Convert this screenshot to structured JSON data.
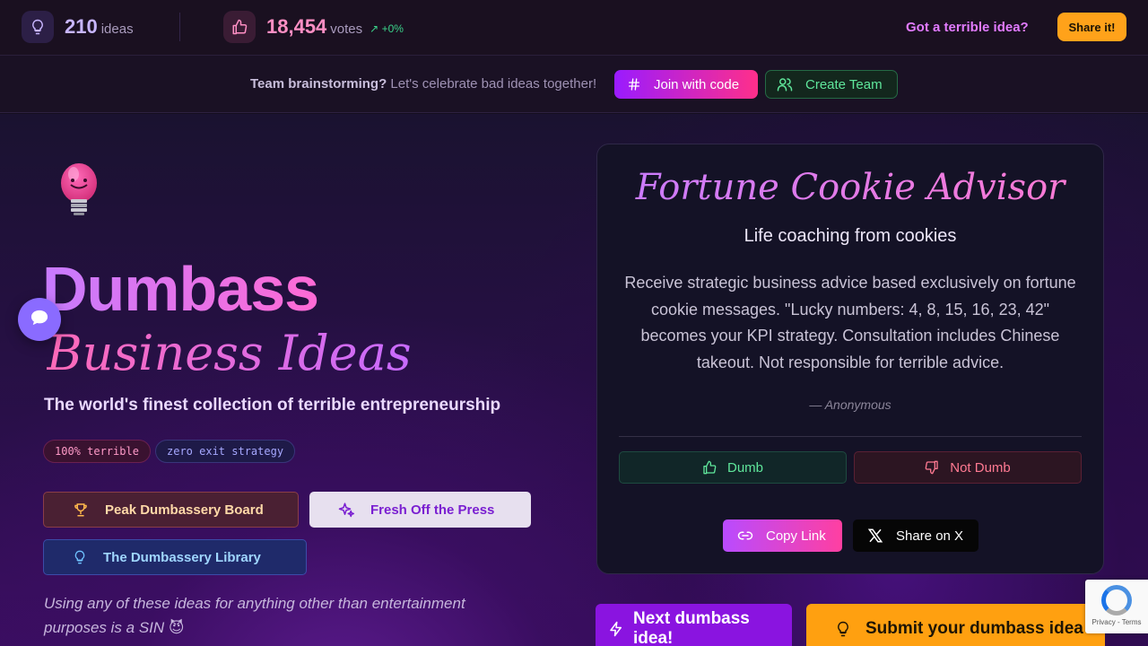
{
  "topbar": {
    "ideas_count": "210",
    "ideas_unit": "ideas",
    "votes_count": "18,454",
    "votes_unit": "votes",
    "votes_trend": "+0%",
    "cta_text": "Got a terrible idea?",
    "share_label": "Share it!"
  },
  "teambar": {
    "prompt_bold": "Team brainstorming?",
    "prompt_rest": "Let's celebrate bad ideas together!",
    "join_label": "Join with code",
    "create_label": "Create Team"
  },
  "hero": {
    "title_line1": "Dumbass",
    "title_line2": "Business Ideas",
    "tagline": "The world's finest collection of terrible entrepreneurship",
    "chips": [
      "100% terrible",
      "zero exit strategy"
    ],
    "nav": {
      "peak": "Peak Dumbassery Board",
      "fresh": "Fresh Off the Press",
      "library": "The Dumbassery Library"
    },
    "disclaimer": "Using any of these ideas for anything other than entertainment purposes is a SIN 😈"
  },
  "card": {
    "title": "Fortune Cookie Advisor",
    "subtitle": "Life coaching from cookies",
    "body": "Receive strategic business advice based exclusively on fortune cookie messages. \"Lucky numbers: 4, 8, 15, 16, 23, 42\" becomes your KPI strategy. Consultation includes Chinese takeout. Not responsible for terrible advice.",
    "author": "— Anonymous",
    "dumb_label": "Dumb",
    "not_dumb_label": "Not Dumb",
    "copy_label": "Copy Link",
    "share_x_label": "Share on X"
  },
  "actions": {
    "next_label": "Next dumbass idea!",
    "submit_label": "Submit your dumbass idea"
  },
  "recaptcha": {
    "text": "Privacy - Terms"
  },
  "colors": {
    "accent_purple": "#9a1bff",
    "accent_pink": "#ff2f8a",
    "accent_orange": "#ffa21a",
    "success_green": "#5fe69b",
    "danger_red": "#ff7a92"
  }
}
